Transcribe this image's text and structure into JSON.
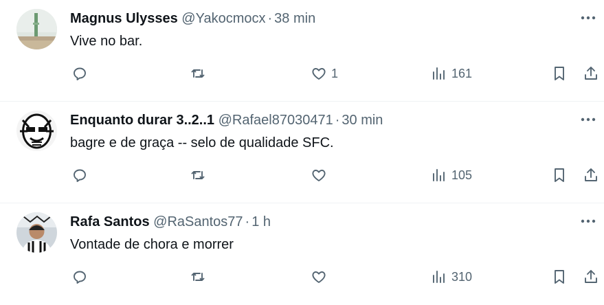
{
  "tweets": [
    {
      "name": "Magnus Ulysses",
      "handle": "@Yakocmocx",
      "dot": "·",
      "time": "38 min",
      "text": "Vive no bar.",
      "likes": "1",
      "views": "161",
      "avatar_colors": {
        "bg": "#cfd8d3",
        "accent": "#7a9a7d"
      }
    },
    {
      "name": "Enquanto durar 3..2..1",
      "handle": "@Rafael87030471",
      "dot": "·",
      "time": "30 min",
      "text": "bagre e de graça -- selo de qualidade SFC.",
      "likes": "",
      "views": "105",
      "avatar_colors": {
        "bg": "#f2f2f2",
        "accent": "#111111"
      }
    },
    {
      "name": "Rafa Santos",
      "handle": "@RaSantos77",
      "dot": "·",
      "time": "1 h",
      "text": "Vontade de chora e morrer",
      "likes": "",
      "views": "310",
      "avatar_colors": {
        "bg": "#d9dfe4",
        "accent": "#3b3b3b"
      }
    }
  ],
  "icons": {
    "more": "more-dots-icon",
    "reply": "reply-icon",
    "retweet": "retweet-icon",
    "like": "heart-icon",
    "views": "views-icon",
    "bookmark": "bookmark-icon",
    "share": "share-icon"
  },
  "colors": {
    "text": "#0f1419",
    "secondary": "#536471",
    "divider": "#eff3f4"
  }
}
